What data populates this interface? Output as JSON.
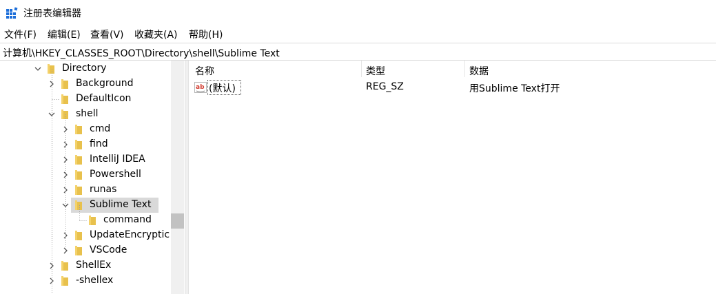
{
  "window": {
    "title": "注册表编辑器"
  },
  "menu": {
    "file": "文件(F)",
    "edit": "编辑(E)",
    "view": "查看(V)",
    "favorites": "收藏夹(A)",
    "help": "帮助(H)"
  },
  "address": {
    "path": "计算机\\HKEY_CLASSES_ROOT\\Directory\\shell\\Sublime Text"
  },
  "tree": {
    "items": [
      {
        "label": "Directory",
        "state": "expanded"
      },
      {
        "label": "Background",
        "state": "collapsed"
      },
      {
        "label": "DefaultIcon",
        "state": "leaf"
      },
      {
        "label": "shell",
        "state": "expanded"
      },
      {
        "label": "cmd",
        "state": "collapsed"
      },
      {
        "label": "find",
        "state": "collapsed"
      },
      {
        "label": "IntelliJ IDEA",
        "state": "collapsed"
      },
      {
        "label": "Powershell",
        "state": "collapsed"
      },
      {
        "label": "runas",
        "state": "collapsed"
      },
      {
        "label": "Sublime Text",
        "state": "expanded",
        "selected": true
      },
      {
        "label": "command",
        "state": "leaf"
      },
      {
        "label": "UpdateEncryptic",
        "state": "collapsed"
      },
      {
        "label": "VSCode",
        "state": "collapsed"
      },
      {
        "label": "ShellEx",
        "state": "collapsed"
      },
      {
        "label": "-shellex",
        "state": "collapsed"
      }
    ]
  },
  "list": {
    "columns": {
      "name": "名称",
      "type": "类型",
      "data": "数据"
    },
    "rows": [
      {
        "name": "(默认)",
        "type": "REG_SZ",
        "data": "用Sublime Text打开",
        "icon": "string-value-icon"
      }
    ]
  },
  "colors": {
    "selection": "#d9d9d9",
    "folder": "#e8c14d",
    "app_icon": "#1e6fd9",
    "value_icon_text": "#d23b2f"
  }
}
